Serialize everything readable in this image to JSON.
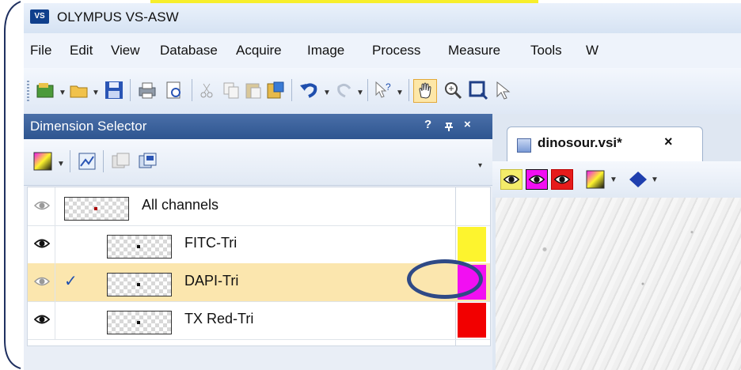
{
  "window": {
    "title": "OLYMPUS VS-ASW",
    "logo_text": "VS"
  },
  "menu": [
    "File",
    "Edit",
    "View",
    "Database",
    "Acquire",
    "Image",
    "Process",
    "Measure",
    "Tools",
    "W"
  ],
  "toolbar": {
    "icons": [
      "open-image-icon",
      "open-folder-icon",
      "save-icon",
      "print-icon",
      "print-preview-icon",
      "cut-icon",
      "copy-icon",
      "paste-icon",
      "paste-special-icon",
      "undo-icon",
      "redo-icon",
      "help-icon",
      "pan-hand-icon",
      "zoom-icon",
      "select-rect-icon"
    ]
  },
  "panel": {
    "title": "Dimension Selector",
    "controls": [
      "?",
      "↑",
      "×"
    ],
    "rows": [
      {
        "label": "All channels",
        "eye": "dim",
        "checked": false,
        "color": ""
      },
      {
        "label": "FITC-Tri",
        "eye": "dark",
        "checked": false,
        "color": "#fdf42e"
      },
      {
        "label": "DAPI-Tri",
        "eye": "dim",
        "checked": true,
        "color": "#f20ff2"
      },
      {
        "label": "TX Red-Tri",
        "eye": "dark",
        "checked": false,
        "color": "#f20000"
      }
    ]
  },
  "document": {
    "tab_label": "dinosour.vsi*",
    "close": "×"
  },
  "colors": {
    "accent": "#2e5590",
    "selection": "#fbe6ae",
    "callout": "#2f4a86",
    "highlight": "#f7ee2b"
  }
}
